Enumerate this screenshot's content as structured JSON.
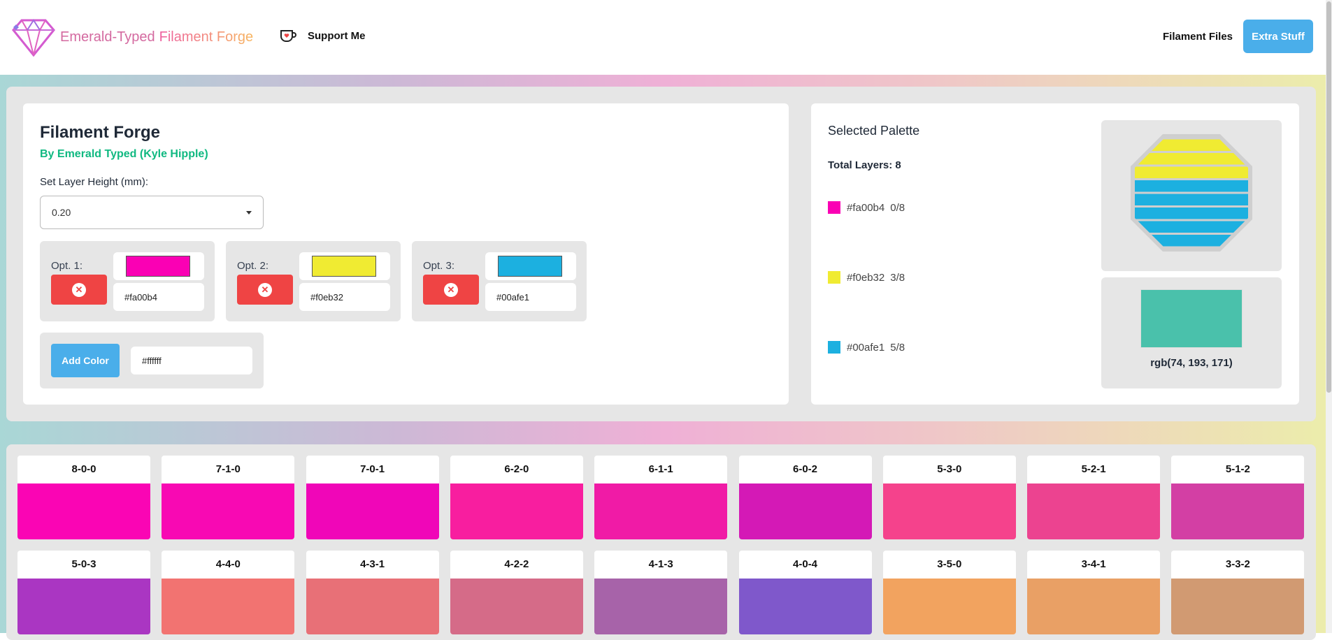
{
  "header": {
    "brand_part1": "Emerald-Typed",
    "brand_part2": "Filament Forge",
    "support_label": "Support Me",
    "nav_files": "Filament Files",
    "nav_extra": "Extra Stuff"
  },
  "forge": {
    "title": "Filament Forge",
    "byline": "By Emerald Typed (Kyle Hipple)",
    "layer_height_label": "Set Layer Height (mm):",
    "layer_height_value": "0.20",
    "options": [
      {
        "label": "Opt. 1:",
        "hex": "#fa00b4",
        "color": "#fa00b4"
      },
      {
        "label": "Opt. 2:",
        "hex": "#f0eb32",
        "color": "#f0eb32"
      },
      {
        "label": "Opt. 3:",
        "hex": "#00afe1",
        "color": "#1cb0e0"
      }
    ],
    "add_color_label": "Add Color",
    "add_color_value": "#ffffff"
  },
  "palette": {
    "title": "Selected Palette",
    "total_layers": "Total Layers: 8",
    "entries": [
      {
        "hex": "#fa00b4",
        "count": "0/8",
        "color": "#fa00b4"
      },
      {
        "hex": "#f0eb32",
        "count": "3/8",
        "color": "#f0eb32"
      },
      {
        "hex": "#00afe1",
        "count": "5/8",
        "color": "#1cb0e0"
      }
    ],
    "preview_layers": [
      "#f0eb32",
      "#f0eb32",
      "#f0eb32",
      "#1cb0e0",
      "#1cb0e0",
      "#1cb0e0",
      "#1cb0e0",
      "#1cb0e0"
    ],
    "result_color": "#4ac1ab",
    "result_text": "rgb(74, 193, 171)"
  },
  "combos": [
    {
      "label": "8-0-0",
      "color": "#fa05b4"
    },
    {
      "label": "7-1-0",
      "color": "#f809b3"
    },
    {
      "label": "7-0-1",
      "color": "#f006b8"
    },
    {
      "label": "6-2-0",
      "color": "#f81e9f"
    },
    {
      "label": "6-1-1",
      "color": "#f01ba6"
    },
    {
      "label": "6-0-2",
      "color": "#d419b6"
    },
    {
      "label": "5-3-0",
      "color": "#f5428c"
    },
    {
      "label": "5-2-1",
      "color": "#ec4390"
    },
    {
      "label": "5-1-2",
      "color": "#d33fa4"
    },
    {
      "label": "5-0-3",
      "color": "#aa36c2"
    },
    {
      "label": "4-4-0",
      "color": "#f27371"
    },
    {
      "label": "4-3-1",
      "color": "#e87077"
    },
    {
      "label": "4-2-2",
      "color": "#d56b88"
    },
    {
      "label": "4-1-3",
      "color": "#a763a9"
    },
    {
      "label": "4-0-4",
      "color": "#7f58cb"
    },
    {
      "label": "3-5-0",
      "color": "#f2a35f"
    },
    {
      "label": "3-4-1",
      "color": "#e9a065"
    },
    {
      "label": "3-3-2",
      "color": "#d19a72"
    }
  ],
  "colors": {
    "accent_blue": "#4aaeea",
    "remove_red": "#ef4444",
    "byline_green": "#10b981"
  }
}
